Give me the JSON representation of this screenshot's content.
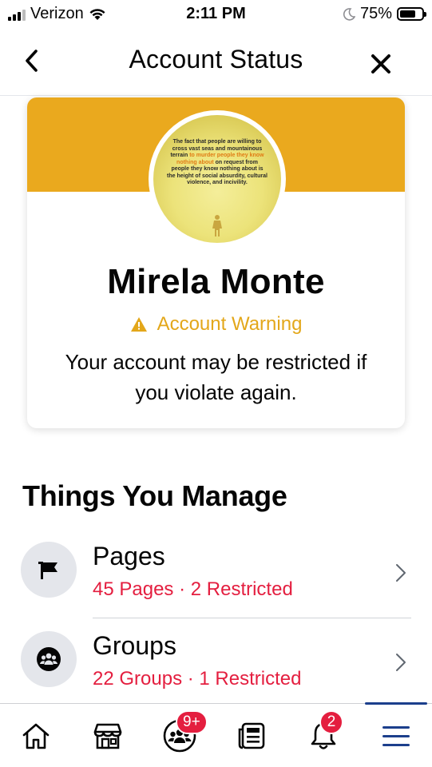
{
  "status_bar": {
    "carrier": "Verizon",
    "time": "2:11 PM",
    "battery": "75%",
    "battery_level": 0.75
  },
  "header": {
    "title": "Account Status",
    "back_icon": "chevron-left-icon",
    "close_icon": "close-icon"
  },
  "profile": {
    "name": "Mirela Monte",
    "avatar_quote_plain_1": "The fact that people are willing to cross vast seas and mountainous terrain ",
    "avatar_quote_highlight": "to murder people they know nothing about",
    "avatar_quote_plain_2": " on request from people they know nothing about is the height of social absurdity, cultural violence, and incivility.",
    "warning_label": "Account Warning",
    "warning_message": "Your account may be restricted if you violate again."
  },
  "manage": {
    "title": "Things You Manage",
    "items": [
      {
        "title": "Pages",
        "subtitle": "45 Pages · 2 Restricted",
        "icon": "flag-icon"
      },
      {
        "title": "Groups",
        "subtitle": "22 Groups · 1 Restricted",
        "icon": "groups-icon"
      }
    ]
  },
  "tabbar": {
    "groups_badge": "9+",
    "notifications_badge": "2",
    "tabs": [
      "home-icon",
      "marketplace-icon",
      "groups-icon",
      "news-feed-icon",
      "bell-icon",
      "menu-icon"
    ]
  },
  "colors": {
    "cover": "#eaa91e",
    "warning": "#e3a71a",
    "restricted": "#e41e3f",
    "active_tab": "#1c3f8c"
  }
}
